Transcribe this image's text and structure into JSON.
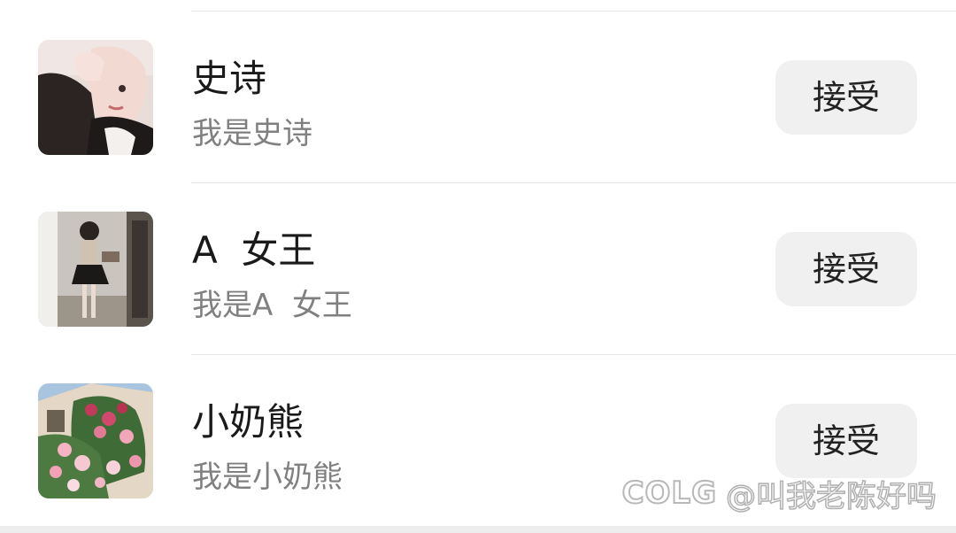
{
  "requests": [
    {
      "name": "史诗",
      "message": "我是史诗",
      "action_label": "接受",
      "avatar": "avatar-girl-selfie"
    },
    {
      "name": "A  女王",
      "message": "我是A  女王",
      "action_label": "接受",
      "avatar": "avatar-girl-mirror"
    },
    {
      "name": "小奶熊",
      "message": "我是小奶熊",
      "action_label": "接受",
      "avatar": "avatar-roses-house"
    }
  ],
  "watermark": {
    "logo": "COLG",
    "text": "@叫我老陈好吗"
  },
  "colors": {
    "background": "#ffffff",
    "button_bg": "#f0f0f0",
    "name_text": "#1a1a1a",
    "message_text": "#808080",
    "divider": "#e6e6e6"
  }
}
